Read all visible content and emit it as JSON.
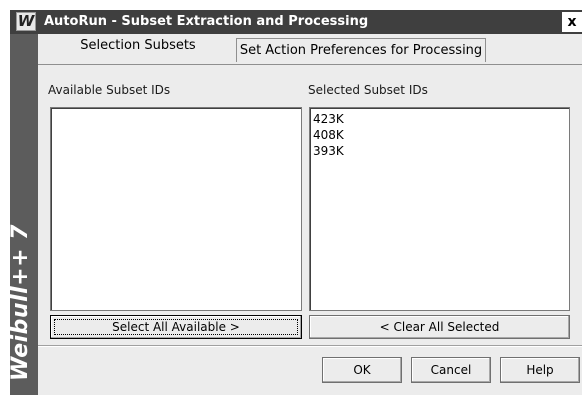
{
  "window": {
    "icon_glyph": "W",
    "title": "AutoRun - Subset Extraction and Processing",
    "close_glyph": "x"
  },
  "sidebar": {
    "brand": "Weibull++ 7"
  },
  "tabs": [
    {
      "label": "Selection Subsets",
      "active": true
    },
    {
      "label": "Set Action Preferences for Processing",
      "active": false
    }
  ],
  "available": {
    "label": "Available Subset IDs",
    "items": []
  },
  "selected": {
    "label": "Selected Subset IDs",
    "items": [
      "423K",
      "408K",
      "393K"
    ]
  },
  "buttons": {
    "select_all": "Select All Available  >",
    "clear_all": "<  Clear All Selected",
    "ok": "OK",
    "cancel": "Cancel",
    "help": "Help"
  },
  "icons": {
    "app": "weibull-app-icon",
    "close": "close-icon"
  }
}
